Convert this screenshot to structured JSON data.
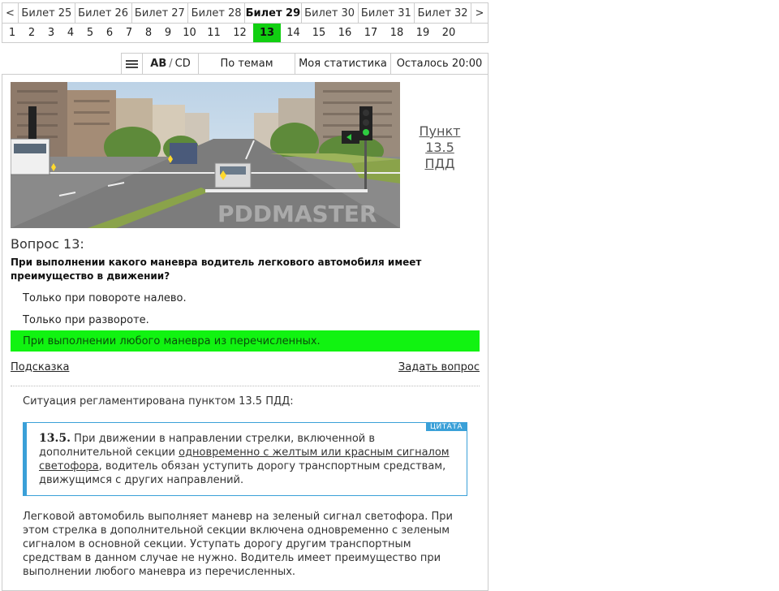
{
  "tickets": {
    "prev": "<",
    "next": ">",
    "items": [
      "Билет 25",
      "Билет 26",
      "Билет 27",
      "Билет 28",
      "Билет 29",
      "Билет 30",
      "Билет 31",
      "Билет 32"
    ],
    "active_index": 4
  },
  "question_numbers": {
    "items": [
      "1",
      "2",
      "3",
      "4",
      "5",
      "6",
      "7",
      "8",
      "9",
      "10",
      "11",
      "12",
      "13",
      "14",
      "15",
      "16",
      "17",
      "18",
      "19",
      "20"
    ],
    "current": "13"
  },
  "toolbar": {
    "category_ab": "AB",
    "category_sep": "/",
    "category_cd": "CD",
    "topics": "По темам",
    "stats": "Моя статистика",
    "time_left": "Осталось 20:00"
  },
  "question": {
    "image_watermark": "PDDMASTER",
    "rule_link": [
      "Пункт",
      "13.5",
      "ПДД"
    ],
    "title": "Вопрос 13:",
    "text": "При выполнении какого маневра водитель легкового автомобиля имеет преимущество в движении?",
    "answers": [
      {
        "text": "Только при повороте налево.",
        "correct": false
      },
      {
        "text": "Только при развороте.",
        "correct": false
      },
      {
        "text": "При выполнении любого маневра из перечисленных.",
        "correct": true
      }
    ]
  },
  "links": {
    "hint": "Подсказка",
    "ask": "Задать вопрос"
  },
  "explanation": {
    "intro": "Ситуация регламентирована пунктом 13.5 ПДД:",
    "quote_tag": "ЦИТАТА",
    "quote_number": "13.5.",
    "quote_part1": " При движении в направлении стрелки, включенной в дополнительной секции ",
    "quote_underlined": "одновременно с желтым или красным сигналом светофора",
    "quote_part2": ", водитель обязан уступить дорогу транспортным средствам, движущимся с других направлений.",
    "body": "Легковой автомобиль выполняет маневр на зеленый сигнал светофора. При этом стрелка в дополнительной секции включена одновременно с зеленым сигналом в основной секции. Уступать дорогу другим транспортным средствам в данном случае не нужно. Водитель имеет преимущество при выполнении любого маневра из перечисленных."
  },
  "colors": {
    "correct_answer": "#11f311",
    "current_question": "#11cf11",
    "quote_accent": "#3aa0d8"
  }
}
